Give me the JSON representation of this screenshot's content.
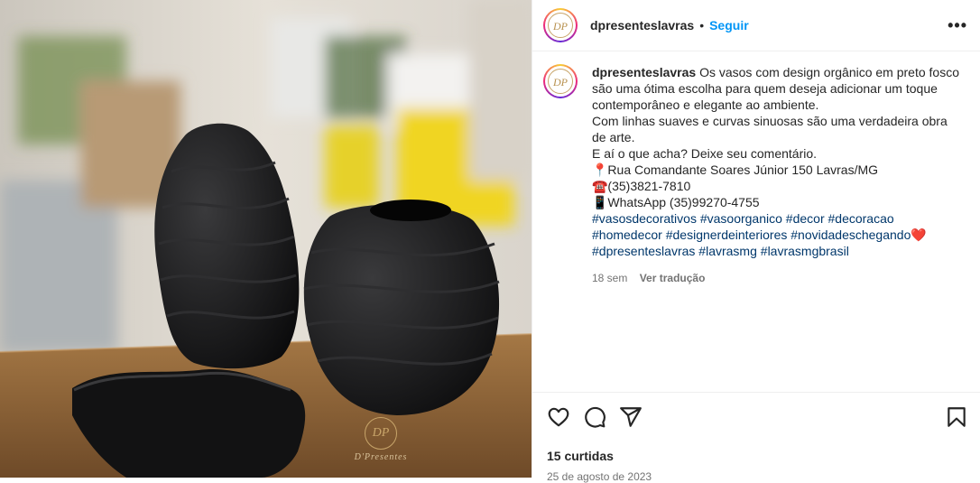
{
  "post": {
    "username": "dpresentes lavras",
    "username_display": "dpresenteslavras",
    "follow_label": "Seguir",
    "separator": "•",
    "more_label": "•••",
    "avatar_text": "DP",
    "watermark": {
      "monogram": "DP",
      "text": "D'Presentes"
    },
    "caption": {
      "text_lines": [
        "Os vasos com design orgânico em preto fosco são uma ótima escolha para quem deseja adicionar um toque contemporâneo e elegante ao ambiente.",
        "Com linhas suaves e curvas sinuosas são uma verdadeira obra de arte.",
        "E aí o que acha? Deixe seu comentário.",
        "📍Rua Comandante Soares Júnior 150 Lavras/MG",
        "☎️(35)3821-7810",
        "📱WhatsApp (35)99270-4755"
      ],
      "hashtags": [
        "#vasosdecorativos",
        "#vasoorganico",
        "#decor",
        "#decoracao",
        "#homedecor",
        "#designerdeinteriores",
        "#novidadeschegando",
        "#dpresenteslavras",
        "#lavrasmg",
        "#lavrasmgbrasil"
      ],
      "heart_emoji": "❤️"
    },
    "time_ago": "18 sem",
    "translate_label": "Ver tradução",
    "likes_label": "15 curtidas",
    "date_label": "25 de agosto de 2023",
    "icons": [
      "heart-icon",
      "comment-icon",
      "share-icon",
      "bookmark-icon"
    ],
    "colors": {
      "link": "#0095f6",
      "hashtag": "#00376b",
      "muted": "#737373",
      "text": "#262626"
    }
  }
}
